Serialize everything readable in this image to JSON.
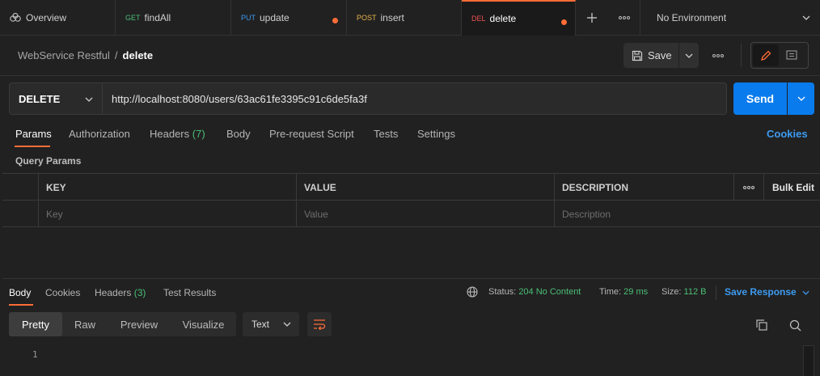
{
  "tabs": [
    {
      "method": "",
      "title": "Overview",
      "method_color": "#bbbbbb"
    },
    {
      "method": "GET",
      "title": "findAll",
      "method_color": "#4cbe76"
    },
    {
      "method": "PUT",
      "title": "update",
      "method_color": "#3d9bf0"
    },
    {
      "method": "POST",
      "title": "insert",
      "method_color": "#e9b44c"
    },
    {
      "method": "DEL",
      "title": "delete",
      "method_color": "#f05252"
    }
  ],
  "environment": "No Environment",
  "breadcrumb": {
    "parent": "WebService Restful",
    "separator": "/",
    "current": "delete"
  },
  "save_label": "Save",
  "request": {
    "method": "DELETE",
    "url": "http://localhost:8080/users/63ac61fe3395c91c6de5fa3f",
    "send_label": "Send"
  },
  "req_tabs": {
    "params": "Params",
    "authorization": "Authorization",
    "headers": "Headers",
    "headers_count": "(7)",
    "body": "Body",
    "prerequest": "Pre-request Script",
    "tests": "Tests",
    "settings": "Settings",
    "cookies": "Cookies"
  },
  "query_params_title": "Query Params",
  "params_table": {
    "headers": {
      "key": "KEY",
      "value": "VALUE",
      "description": "DESCRIPTION",
      "bulk_edit": "Bulk Edit"
    },
    "placeholders": {
      "key": "Key",
      "value": "Value",
      "description": "Description"
    }
  },
  "response": {
    "tabs": {
      "body": "Body",
      "cookies": "Cookies",
      "headers": "Headers",
      "headers_count": "(3)",
      "test_results": "Test Results"
    },
    "status_label": "Status:",
    "status_value": "204 No Content",
    "time_label": "Time:",
    "time_value": "29 ms",
    "size_label": "Size:",
    "size_value": "112 B",
    "save_response": "Save Response",
    "formats": [
      "Pretty",
      "Raw",
      "Preview",
      "Visualize"
    ],
    "selected_format": "Pretty",
    "language": "Text",
    "line_number": "1"
  },
  "colors": {
    "accent": "#ff6c37",
    "send": "#097bed",
    "link": "#3d9bf0",
    "success": "#4cbe76"
  }
}
